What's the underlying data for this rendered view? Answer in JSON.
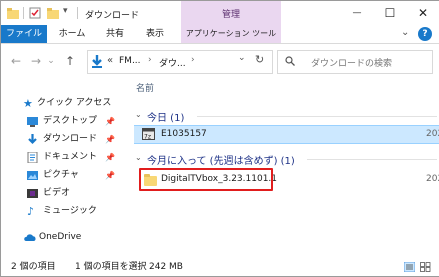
{
  "window": {
    "title": "ダウンロード",
    "contextual_tab": "管理",
    "minimize_glyph": "—",
    "maximize_glyph": "☐",
    "close_glyph": "✕"
  },
  "ribbon": {
    "tabs": [
      "ファイル",
      "ホーム",
      "共有",
      "表示",
      "アプリケーション ツール"
    ],
    "expand_glyph": "⌄",
    "help_glyph": "?"
  },
  "address": {
    "back_glyph": "←",
    "forward_glyph": "→",
    "dropdown_glyph": "⌄",
    "up_glyph": "↑",
    "path_overflow": "«",
    "path_parts": [
      "FM...",
      "ダウ..."
    ],
    "sep": "›",
    "refresh_glyph": "↻"
  },
  "search": {
    "placeholder": "ダウンロードの検索"
  },
  "nav": {
    "quick_access": "クイック アクセス",
    "items": [
      {
        "label": "デスクトップ",
        "icon": "desktop-icon"
      },
      {
        "label": "ダウンロード",
        "icon": "download-arrow-icon"
      },
      {
        "label": "ドキュメント",
        "icon": "document-icon"
      },
      {
        "label": "ピクチャ",
        "icon": "picture-icon"
      },
      {
        "label": "ビデオ",
        "icon": "video-icon"
      },
      {
        "label": "ミュージック",
        "icon": "music-note-icon"
      }
    ],
    "onedrive": "OneDrive"
  },
  "files": {
    "column_name": "名前",
    "groups": [
      {
        "header": "今日 (1)",
        "items": [
          {
            "name": "E1035157",
            "date": "202",
            "selected": true,
            "icon": "executable-icon"
          }
        ]
      },
      {
        "header": "今月に入って (先週は含めず) (1)",
        "items": [
          {
            "name": "DigitalTVbox_3.23.1101.1",
            "date": "202",
            "selected": false,
            "icon": "folder-icon"
          }
        ]
      }
    ]
  },
  "status": {
    "count": "2 個の項目",
    "selection": "1 個の項目を選択",
    "size": "242 MB"
  },
  "colors": {
    "accent": "#1979ca",
    "manage_band": "#ead7f0",
    "selection": "#cce8ff",
    "highlight_box": "#e11d1d"
  }
}
